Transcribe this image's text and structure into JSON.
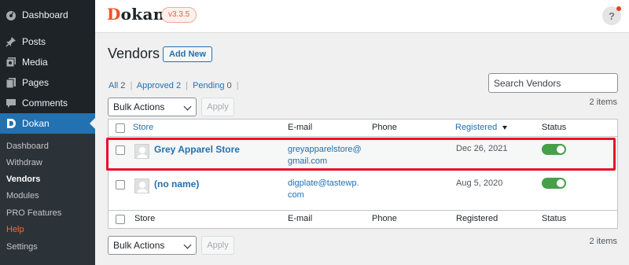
{
  "sidebar": {
    "items": [
      {
        "label": "Dashboard",
        "icon": "dashboard-icon"
      },
      {
        "label": "Posts",
        "icon": "pin-icon"
      },
      {
        "label": "Media",
        "icon": "media-icon"
      },
      {
        "label": "Pages",
        "icon": "pages-icon"
      },
      {
        "label": "Comments",
        "icon": "comments-icon"
      },
      {
        "label": "Dokan",
        "icon": "dokan-icon",
        "active": true
      }
    ],
    "submenu": [
      {
        "label": "Dashboard"
      },
      {
        "label": "Withdraw"
      },
      {
        "label": "Vendors",
        "current": true
      },
      {
        "label": "Modules"
      },
      {
        "label": "PRO Features"
      },
      {
        "label": "Help"
      },
      {
        "label": "Settings"
      }
    ]
  },
  "topbar": {
    "logo_initial": "D",
    "logo_rest": "okan",
    "version": "v3.3.5",
    "help_label": "?"
  },
  "page": {
    "title": "Vendors",
    "add_new": "Add New"
  },
  "filters": {
    "all_label": "All",
    "all_count": "2",
    "approved_label": "Approved",
    "approved_count": "2",
    "pending_label": "Pending",
    "pending_count": "0",
    "separator": "|"
  },
  "search": {
    "placeholder": "Search Vendors"
  },
  "bulk_actions": {
    "label": "Bulk Actions",
    "apply": "Apply",
    "items_count": "2 items"
  },
  "table": {
    "columns": [
      "Store",
      "E-mail",
      "Phone",
      "Registered",
      "Status"
    ],
    "rows": [
      {
        "store": "Grey Apparel Store",
        "email_line1": "greyapparelstore@",
        "email_line2": "gmail.com",
        "phone": "",
        "registered": "Dec 26, 2021",
        "status_enabled": true
      },
      {
        "store": "(no name)",
        "email_line1": "digplate@tastewp.",
        "email_line2": "com",
        "phone": "",
        "registered": "Aug 5, 2020",
        "status_enabled": true
      }
    ]
  },
  "colors": {
    "sidebar_bg": "#1d2327",
    "active_menu": "#2271b1",
    "link": "#2271b1",
    "toggle_on": "#46a049",
    "highlight": "#e8102a",
    "brand": "#f05025"
  }
}
